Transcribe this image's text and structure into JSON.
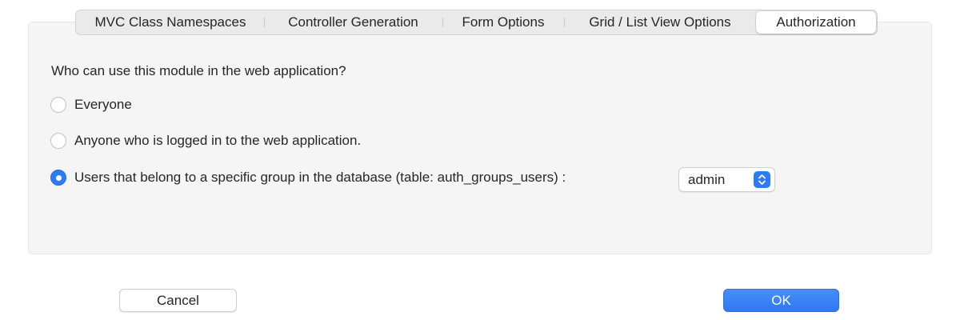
{
  "tabs": [
    {
      "label": "MVC Class Namespaces",
      "active": false
    },
    {
      "label": "Controller Generation",
      "active": false
    },
    {
      "label": "Form Options",
      "active": false
    },
    {
      "label": "Grid / List View Options",
      "active": false
    },
    {
      "label": "Authorization",
      "active": true
    }
  ],
  "authorization": {
    "question": "Who can use this module in the web application?",
    "options": [
      {
        "label": "Everyone",
        "checked": false
      },
      {
        "label": "Anyone who is logged in to the web application.",
        "checked": false
      },
      {
        "label": "Users that belong to a specific group in the database (table: auth_groups_users) :",
        "checked": true
      }
    ],
    "group_select": {
      "value": "admin"
    }
  },
  "buttons": {
    "cancel_label": "Cancel",
    "ok_label": "OK"
  },
  "colors": {
    "accent": "#2f7bf6",
    "panel_bg": "#f5f5f5"
  },
  "icons": {
    "select_arrows": "chevron-up-down-icon"
  }
}
